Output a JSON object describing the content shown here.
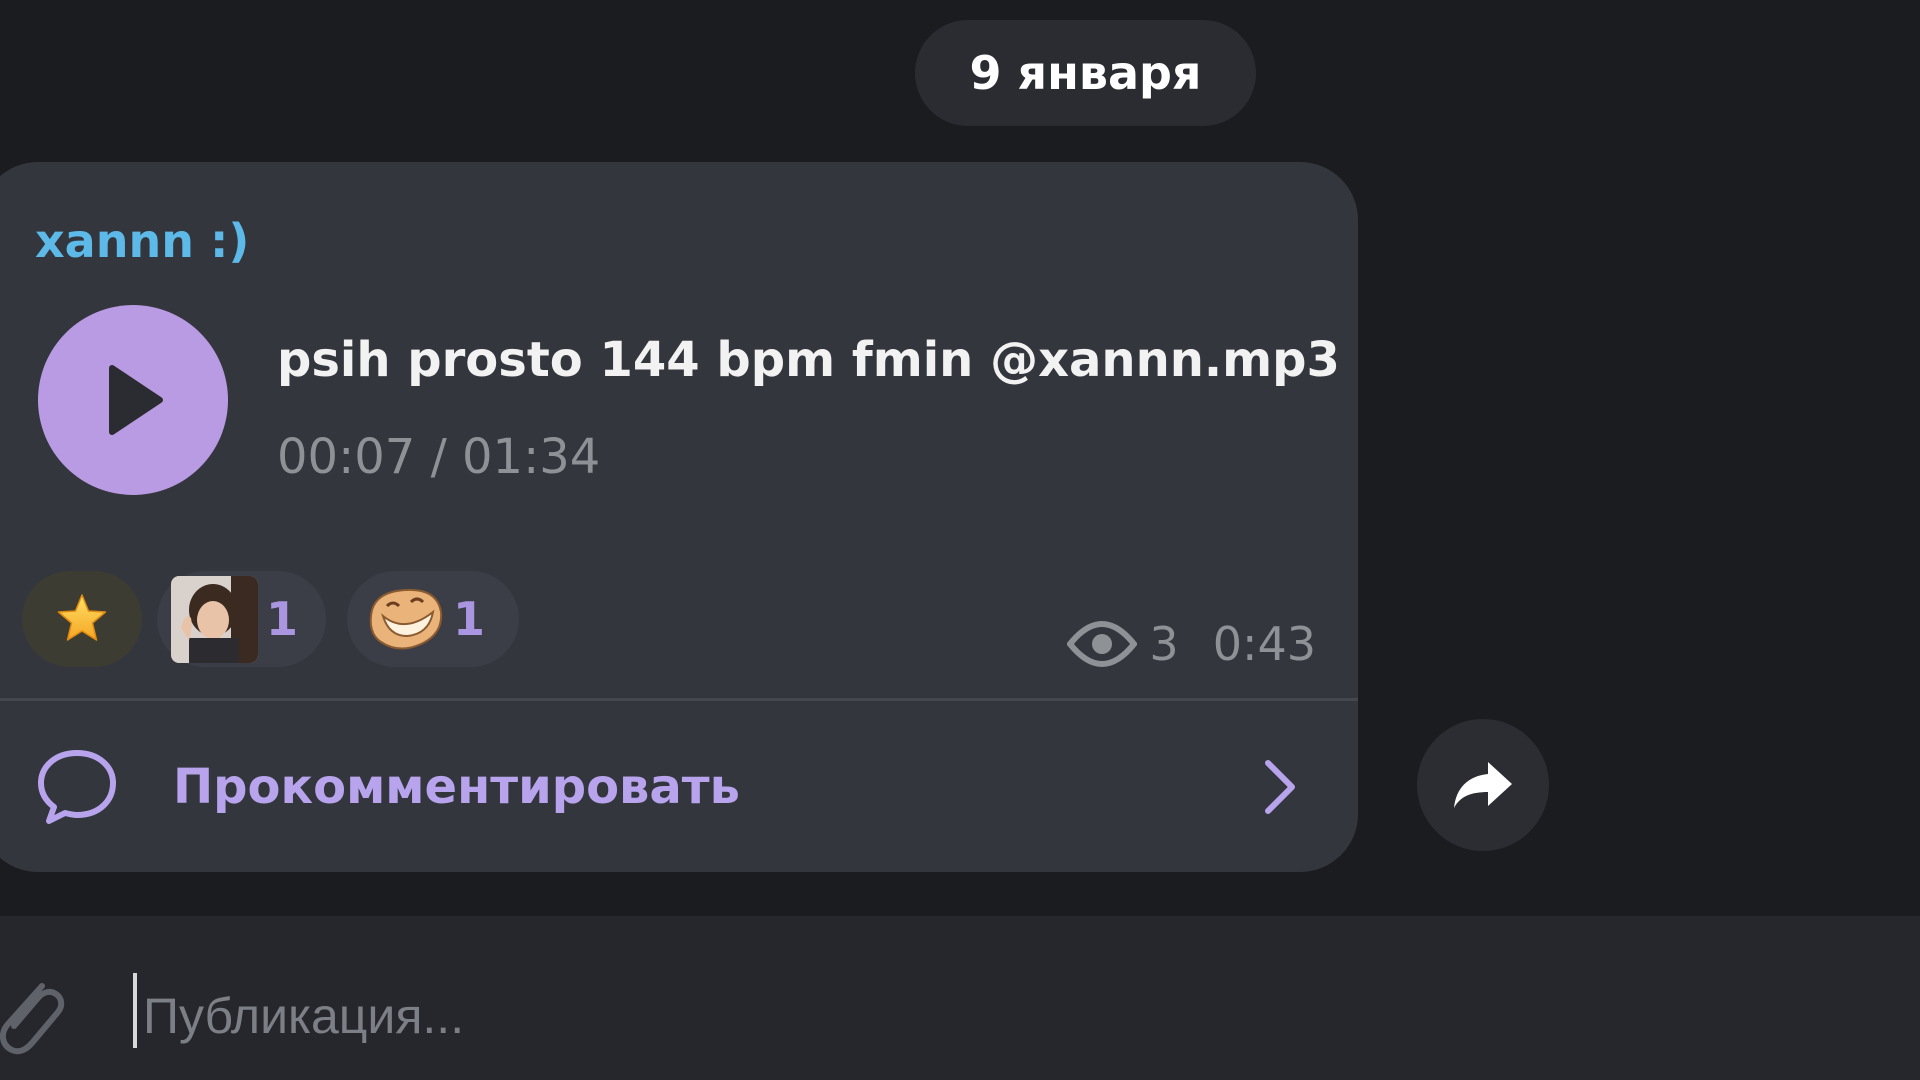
{
  "chat": {
    "date_separator": "9 января"
  },
  "message": {
    "author": "xannn :)",
    "audio": {
      "file_name": "psih prosto 144 bpm fmin @xannn.mp3",
      "time": "00:07 / 01:34",
      "play_icon": "play-icon"
    },
    "reactions": [
      {
        "emoji": "star-icon",
        "count": ""
      },
      {
        "emoji": "user-photo",
        "count": "1"
      },
      {
        "emoji": "troll-face-icon",
        "count": "1"
      }
    ],
    "views": "3",
    "timestamp": "0:43",
    "comment_label": "Прокомментировать"
  },
  "composer": {
    "placeholder": "Публикация..."
  },
  "colors": {
    "accent": "#b99be3",
    "author": "#5cb9e8",
    "link": "#b7a4ec",
    "bubble": "#33363d",
    "background": "#1b1c20"
  }
}
